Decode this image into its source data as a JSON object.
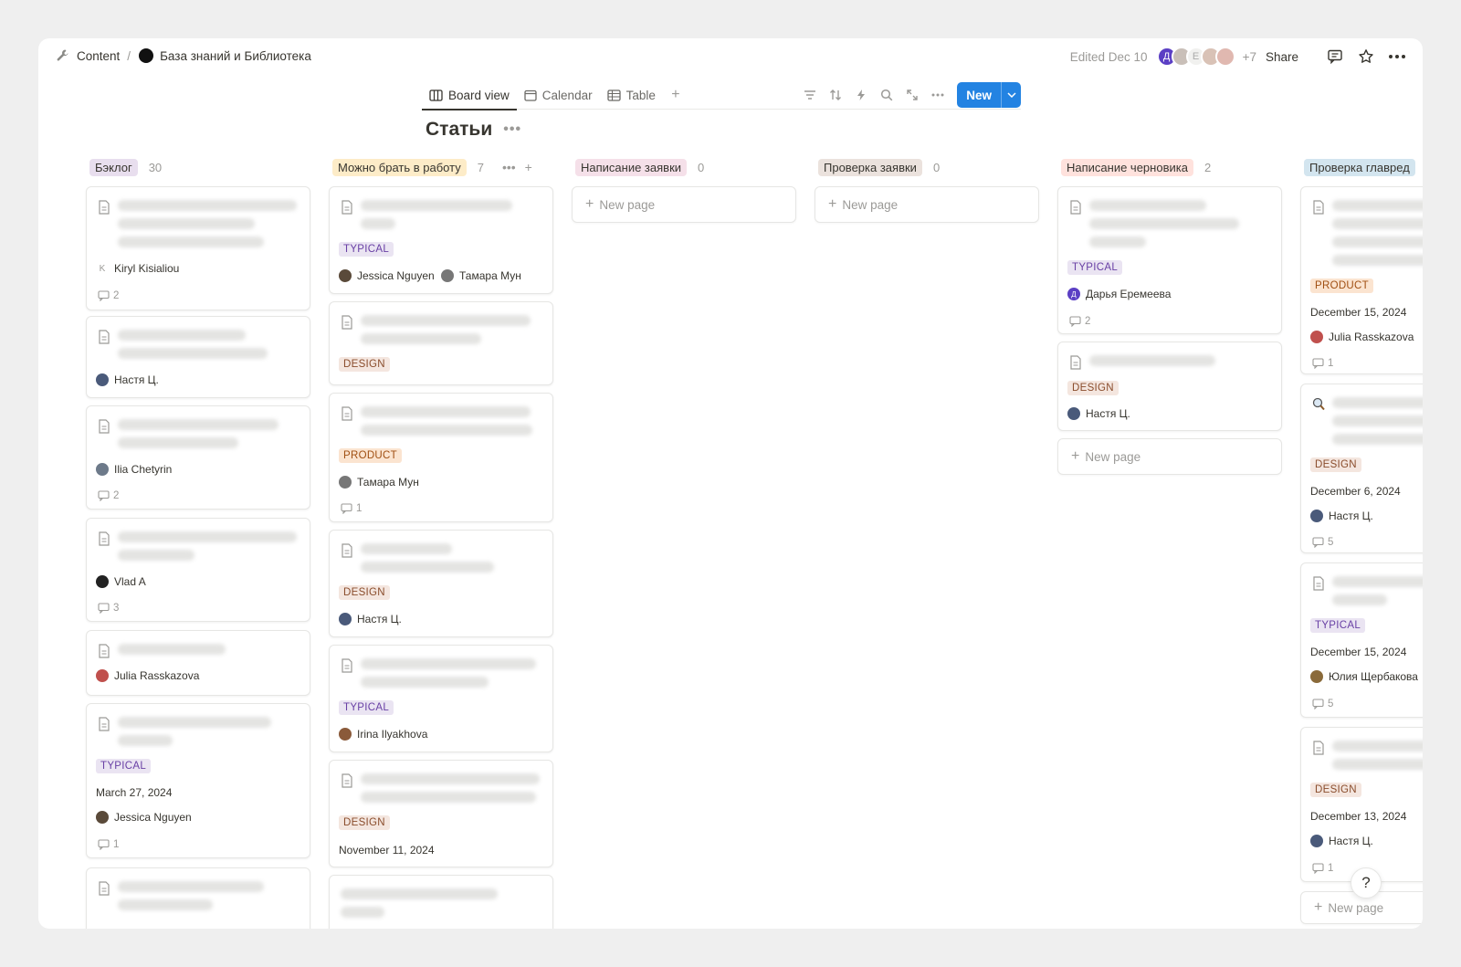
{
  "breadcrumb": {
    "workspace": "Content",
    "page": "База знаний и Библиотека"
  },
  "header": {
    "edited": "Edited Dec 10",
    "avatar_initial": "Д",
    "avatar_e": "E",
    "extra_members": "+7",
    "share": "Share"
  },
  "views": {
    "board": "Board view",
    "calendar": "Calendar",
    "table": "Table",
    "add": "+"
  },
  "toolbar": {
    "new_label": "New"
  },
  "page_title": "Статьи",
  "columns": [
    {
      "name": "Бэклог",
      "count": "30",
      "color": "#e8deee",
      "cards": [
        {
          "people": [
            {
              "name": "Kiryl Kisialiou",
              "initial": "K"
            }
          ],
          "comments": "2"
        },
        {
          "people": [
            {
              "name": "Настя Ц."
            }
          ]
        },
        {
          "people": [
            {
              "name": "Ilia Chetyrin"
            }
          ],
          "comments": "2"
        },
        {
          "people": [
            {
              "name": "Vlad A"
            }
          ],
          "comments": "3"
        },
        {
          "people": [
            {
              "name": "Julia Rasskazova"
            }
          ]
        },
        {
          "tag": "TYPICAL",
          "date": "March 27, 2024",
          "people": [
            {
              "name": "Jessica Nguyen"
            }
          ],
          "comments": "1"
        },
        {}
      ]
    },
    {
      "name": "Можно брать в работу",
      "count": "7",
      "color": "#fdecc8",
      "cards": [
        {
          "tag": "TYPICAL",
          "people": [
            {
              "name": "Jessica Nguyen"
            },
            {
              "name": "Тамара Мун"
            }
          ]
        },
        {
          "tag": "DESIGN"
        },
        {
          "tag": "PRODUCT",
          "people": [
            {
              "name": "Тамара Мун"
            }
          ],
          "comments": "1"
        },
        {
          "tag": "DESIGN",
          "people": [
            {
              "name": "Настя Ц."
            }
          ]
        },
        {
          "tag": "TYPICAL",
          "people": [
            {
              "name": "Irina Ilyakhova"
            }
          ]
        },
        {
          "tag": "DESIGN",
          "date": "November 11, 2024"
        },
        {}
      ]
    },
    {
      "name": "Написание заявки",
      "count": "0",
      "color": "#f5e0e9",
      "new_page": "New page"
    },
    {
      "name": "Проверка заявки",
      "count": "0",
      "color": "#ebe2dd",
      "new_page": "New page"
    },
    {
      "name": "Написание черновика",
      "count": "2",
      "color": "#ffe2dd",
      "new_page": "New page",
      "cards": [
        {
          "tag": "TYPICAL",
          "people": [
            {
              "name": "Дарья Еремеева",
              "initial": "Д"
            }
          ],
          "comments": "2"
        },
        {
          "tag": "DESIGN",
          "people": [
            {
              "name": "Настя Ц."
            }
          ]
        }
      ]
    },
    {
      "name": "Проверка главред",
      "color": "#d3e5ef",
      "new_page": "New page",
      "cards": [
        {
          "tag": "PRODUCT",
          "date": "December 15, 2024",
          "people": [
            {
              "name": "Julia Rasskazova"
            }
          ],
          "comments": "1"
        },
        {
          "tag": "DESIGN",
          "date": "December 6, 2024",
          "people": [
            {
              "name": "Настя Ц."
            }
          ],
          "comments": "5"
        },
        {
          "tag": "TYPICAL",
          "date": "December 15, 2024",
          "people": [
            {
              "name": "Юлия Щербакова"
            }
          ],
          "comments": "5"
        },
        {
          "tag": "DESIGN",
          "date": "December 13, 2024",
          "people": [
            {
              "name": "Настя Ц."
            }
          ],
          "comments": "1"
        }
      ]
    }
  ],
  "help": "?"
}
